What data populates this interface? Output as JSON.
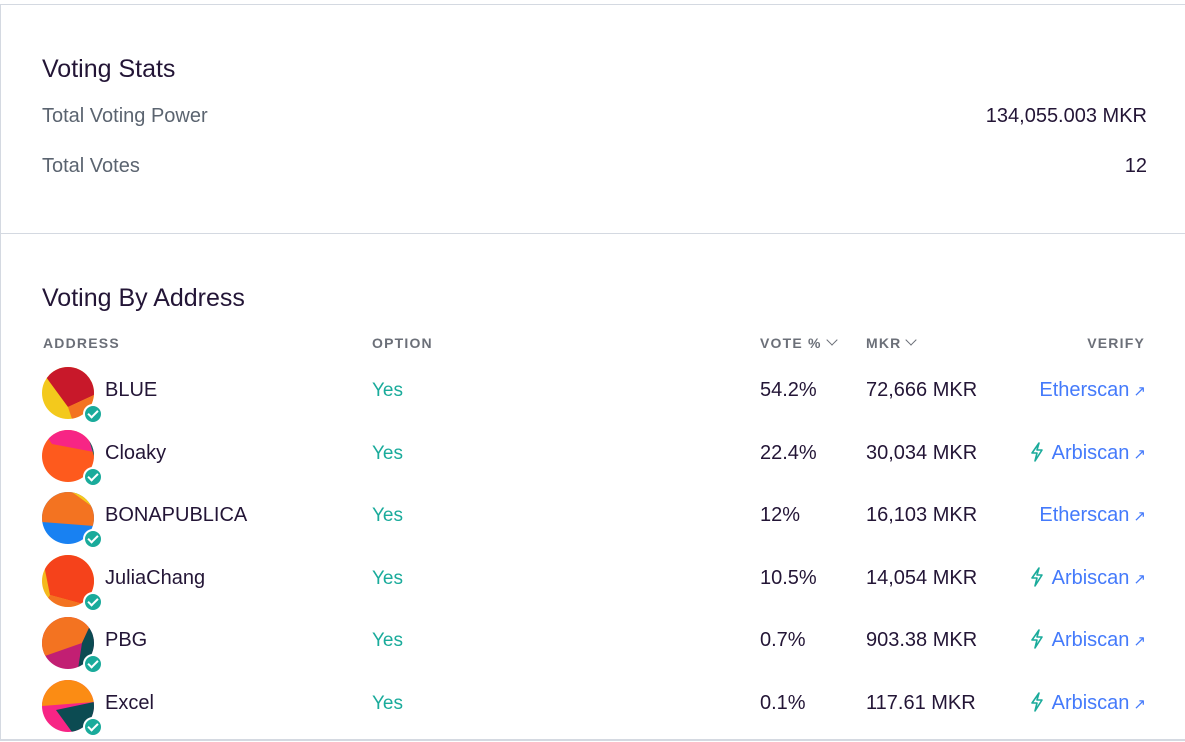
{
  "stats": {
    "title": "Voting Stats",
    "total_power_label": "Total Voting Power",
    "total_power_value": "134,055.003 MKR",
    "total_votes_label": "Total Votes",
    "total_votes_value": "12"
  },
  "voting": {
    "title": "Voting By Address",
    "headers": {
      "address": "ADDRESS",
      "option": "OPTION",
      "vote_pct": "VOTE %",
      "mkr": "MKR",
      "verify": "VERIFY"
    },
    "rows": [
      {
        "name": "BLUE",
        "option": "Yes",
        "pct": "54.2%",
        "mkr": "72,666 MKR",
        "verify": "Etherscan",
        "arrow": "↗",
        "bolt": false
      },
      {
        "name": "Cloaky",
        "option": "Yes",
        "pct": "22.4%",
        "mkr": "30,034 MKR",
        "verify": "Arbiscan",
        "arrow": "↗",
        "bolt": true
      },
      {
        "name": "BONAPUBLICA",
        "option": "Yes",
        "pct": "12%",
        "mkr": "16,103 MKR",
        "verify": "Etherscan",
        "arrow": "↗",
        "bolt": false
      },
      {
        "name": "JuliaChang",
        "option": "Yes",
        "pct": "10.5%",
        "mkr": "14,054 MKR",
        "verify": "Arbiscan",
        "arrow": "↗",
        "bolt": true
      },
      {
        "name": "PBG",
        "option": "Yes",
        "pct": "0.7%",
        "mkr": "903.38 MKR",
        "verify": "Arbiscan",
        "arrow": "↗",
        "bolt": true
      },
      {
        "name": "Excel",
        "option": "Yes",
        "pct": "0.1%",
        "mkr": "117.61 MKR",
        "verify": "Arbiscan",
        "arrow": "↗",
        "bolt": true
      }
    ]
  },
  "colors": {
    "accent_green": "#1aab9b",
    "link_blue": "#447afb",
    "text_dark": "#231536"
  }
}
